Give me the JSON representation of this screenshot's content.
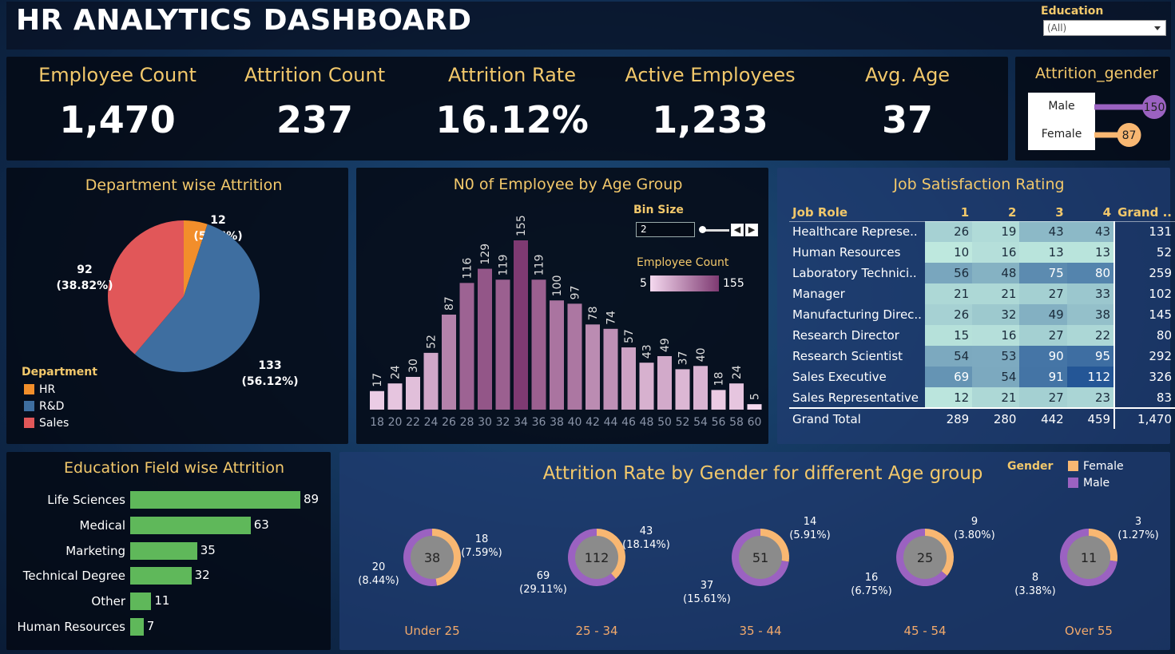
{
  "header": {
    "title": "HR ANALYTICS DASHBOARD",
    "filter_label": "Education",
    "filter_value": "(All)"
  },
  "kpis": [
    {
      "label": "Employee Count",
      "value": "1,470"
    },
    {
      "label": "Attrition Count",
      "value": "237"
    },
    {
      "label": "Attrition Rate",
      "value": "16.12%"
    },
    {
      "label": "Active Employees",
      "value": "1,233"
    },
    {
      "label": "Avg. Age",
      "value": "37"
    }
  ],
  "colors": {
    "gold": "#f2c86b",
    "hr": "#f28e2b",
    "rd": "#3e6ea0",
    "sales": "#e15759",
    "female": "#f8b772",
    "male": "#9b62c1",
    "edu_bar": "#5fb85a"
  },
  "chart_data": [
    {
      "type": "bar",
      "title": "Attrition_gender",
      "categories": [
        "Male",
        "Female"
      ],
      "values": [
        150,
        87
      ]
    },
    {
      "type": "pie",
      "title": "Department wise Attrition",
      "legend_title": "Department",
      "categories": [
        "HR",
        "R&D",
        "Sales"
      ],
      "values": [
        12,
        133,
        92
      ],
      "labels": [
        "(5.06%)",
        "(56.12%)",
        "(38.82%)"
      ]
    },
    {
      "type": "bar",
      "title": "N0 of Employee by Age Group",
      "categories": [
        "18",
        "20",
        "22",
        "24",
        "26",
        "28",
        "30",
        "32",
        "34",
        "36",
        "38",
        "40",
        "42",
        "44",
        "46",
        "48",
        "50",
        "52",
        "54",
        "56",
        "58",
        "60"
      ],
      "values": [
        17,
        24,
        30,
        52,
        87,
        116,
        129,
        119,
        155,
        119,
        100,
        97,
        78,
        74,
        57,
        43,
        49,
        37,
        40,
        18,
        24,
        5
      ],
      "bin_size_label": "Bin Size",
      "bin_size": "2",
      "color_legend_title": "Employee Count",
      "color_min": "5",
      "color_max": "155"
    },
    {
      "type": "table",
      "title": "Job Satisfaction Rating",
      "columns": [
        "Job Role",
        "1",
        "2",
        "3",
        "4",
        "Grand .."
      ],
      "rows": [
        {
          "role": "Healthcare Represe..",
          "values": [
            26,
            19,
            43,
            43
          ],
          "total": "131"
        },
        {
          "role": "Human Resources",
          "values": [
            10,
            16,
            13,
            13
          ],
          "total": "52"
        },
        {
          "role": "Laboratory Technici..",
          "values": [
            56,
            48,
            75,
            80
          ],
          "total": "259"
        },
        {
          "role": "Manager",
          "values": [
            21,
            21,
            27,
            33
          ],
          "total": "102"
        },
        {
          "role": "Manufacturing Direc..",
          "values": [
            26,
            32,
            49,
            38
          ],
          "total": "145"
        },
        {
          "role": "Research Director",
          "values": [
            15,
            16,
            27,
            22
          ],
          "total": "80"
        },
        {
          "role": "Research Scientist",
          "values": [
            54,
            53,
            90,
            95
          ],
          "total": "292"
        },
        {
          "role": "Sales Executive",
          "values": [
            69,
            54,
            91,
            112
          ],
          "total": "326"
        },
        {
          "role": "Sales Representative",
          "values": [
            12,
            21,
            27,
            23
          ],
          "total": "83"
        }
      ],
      "grand_total": {
        "label": "Grand Total",
        "values": [
          "289",
          "280",
          "442",
          "459"
        ],
        "total": "1,470"
      }
    },
    {
      "type": "bar",
      "title": "Education Field wise Attrition",
      "categories": [
        "Life Sciences",
        "Medical",
        "Marketing",
        "Technical Degree",
        "Other",
        "Human Resources"
      ],
      "values": [
        89,
        63,
        35,
        32,
        11,
        7
      ]
    },
    {
      "type": "pie",
      "title": "Attrition Rate by Gender for different Age group",
      "legend_title": "Gender",
      "legend": [
        "Female",
        "Male"
      ],
      "groups": [
        {
          "name": "Under 25",
          "total": "38",
          "female": 18,
          "female_pct": "(7.59%)",
          "male": 20,
          "male_pct": "(8.44%)"
        },
        {
          "name": "25 - 34",
          "total": "112",
          "female": 43,
          "female_pct": "(18.14%)",
          "male": 69,
          "male_pct": "(29.11%)"
        },
        {
          "name": "35 - 44",
          "total": "51",
          "female": 14,
          "female_pct": "(5.91%)",
          "male": 37,
          "male_pct": "(15.61%)"
        },
        {
          "name": "45 - 54",
          "total": "25",
          "female": 9,
          "female_pct": "(3.80%)",
          "male": 16,
          "male_pct": "(6.75%)"
        },
        {
          "name": "Over 55",
          "total": "11",
          "female": 3,
          "female_pct": "(1.27%)",
          "male": 8,
          "male_pct": "(3.38%)"
        }
      ]
    }
  ]
}
